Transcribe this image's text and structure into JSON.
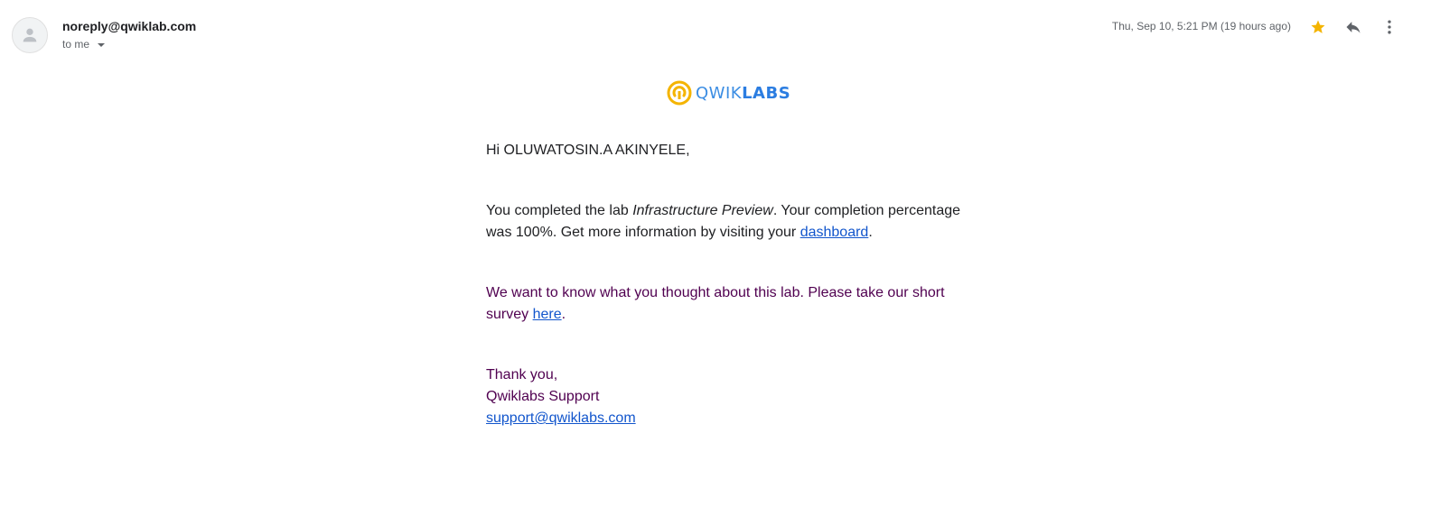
{
  "header": {
    "sender_email": "noreply@qwiklab.com",
    "recipient_label": "to me",
    "timestamp": "Thu, Sep 10, 5:21 PM (19 hours ago)"
  },
  "icons": {
    "avatar": "person-icon",
    "star": "star-icon",
    "reply": "reply-icon",
    "more": "more-vertical-icon",
    "logo": "qwiklabs-logo-icon"
  },
  "colors": {
    "star": "#f4b400",
    "link": "#1155cc",
    "quoted_text": "#500050",
    "logo_yellow": "#f4b400",
    "logo_blue": "#3b8de3"
  },
  "logo": {
    "text_light": "QWIK",
    "text_bold": "LABS"
  },
  "message": {
    "greeting": "Hi OLUWATOSIN.A AKINYELE,",
    "completion_before": "You completed the lab ",
    "lab_name": "Infrastructure Preview",
    "completion_middle": ". Your completion percentage was 100%. Get more information by visiting your ",
    "dashboard_link": "dashboard",
    "completion_end": ".",
    "survey_before": "We want to know what you thought about this lab. Please take our short survey ",
    "survey_link": "here",
    "survey_end": ".",
    "thanks": "Thank you,",
    "team": "Qwiklabs Support",
    "support_email": "support@qwiklabs.com"
  }
}
